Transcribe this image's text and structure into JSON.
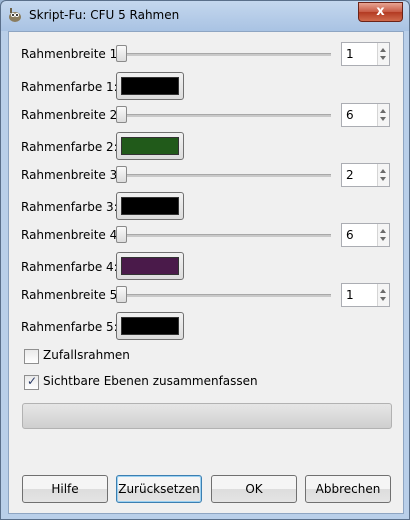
{
  "window": {
    "title": "Skript-Fu: CFU 5 Rahmen",
    "close_label": "x"
  },
  "rows": [
    {
      "type": "slider",
      "label": "Rahmenbreite 1:",
      "value": "1",
      "level": 0.0
    },
    {
      "type": "color",
      "label": "Rahmenfarbe 1:",
      "color": "#000000"
    },
    {
      "type": "slider",
      "label": "Rahmenbreite 2:",
      "value": "6",
      "level": 0.0
    },
    {
      "type": "color",
      "label": "Rahmenfarbe 2:",
      "color": "#215a1a"
    },
    {
      "type": "slider",
      "label": "Rahmenbreite 3:",
      "value": "2",
      "level": 0.0
    },
    {
      "type": "color",
      "label": "Rahmenfarbe 3:",
      "color": "#000000"
    },
    {
      "type": "slider",
      "label": "Rahmenbreite 4:",
      "value": "6",
      "level": 0.0
    },
    {
      "type": "color",
      "label": "Rahmenfarbe 4:",
      "color": "#4a1a4a"
    },
    {
      "type": "slider",
      "label": "Rahmenbreite 5:",
      "value": "1",
      "level": 0.0
    },
    {
      "type": "color",
      "label": "Rahmenfarbe 5:",
      "color": "#000000"
    }
  ],
  "checkboxes": [
    {
      "label": "Zufallsrahmen",
      "checked": false
    },
    {
      "label": "Sichtbare Ebenen zusammenfassen",
      "checked": true
    }
  ],
  "check_mark": "✓",
  "buttons": {
    "help": "Hilfe",
    "reset": "Zurücksetzen",
    "ok": "OK",
    "cancel": "Abbrechen"
  },
  "icons": {
    "app": "gimp-wilber-icon",
    "close": "close-icon"
  }
}
